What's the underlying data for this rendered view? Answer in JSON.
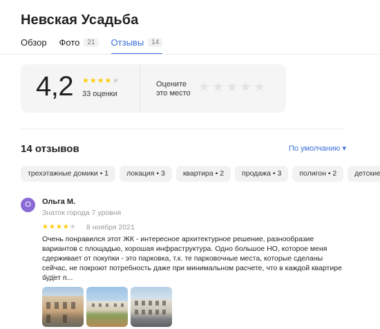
{
  "place": {
    "title": "Невская Усадьба"
  },
  "tabs": [
    {
      "label": "Обзор",
      "count": ""
    },
    {
      "label": "Фото",
      "count": "21"
    },
    {
      "label": "Отзывы",
      "count": "14"
    }
  ],
  "rating": {
    "score": "4,2",
    "stars": 4,
    "stars_total": 5,
    "count_label": "33 оценки",
    "rate_prompt": "Оцените это место"
  },
  "reviews": {
    "count_label": "14 отзывов",
    "sort_label": "По умолчанию ▾",
    "chips": [
      "трехэтажные домики • 1",
      "локация • 3",
      "квартира • 2",
      "продажа • 3",
      "полигон • 2",
      "детские пло"
    ],
    "items": [
      {
        "avatar_letter": "О",
        "author": "Ольга М.",
        "level": "Знаток города 7 уровня",
        "stars": 4,
        "date": "8 ноября 2021",
        "text": "Очень понравился этот ЖК - интересное архитектурное решение, разнообразие вариантов с площадью, хорошая инфраструктура. Одно большое НО, которое меня сдерживает от покупки - это парковка, т.к. те парковочные места, которые сделаны сейчас, не покроют потребность даже при минимальном расчете, что в каждой квартире будет п...",
        "more_label": "ещё"
      }
    ]
  },
  "colors": {
    "accent": "#3a6fd8",
    "star": "#ffcc00",
    "avatar": "#8a6ad6"
  }
}
